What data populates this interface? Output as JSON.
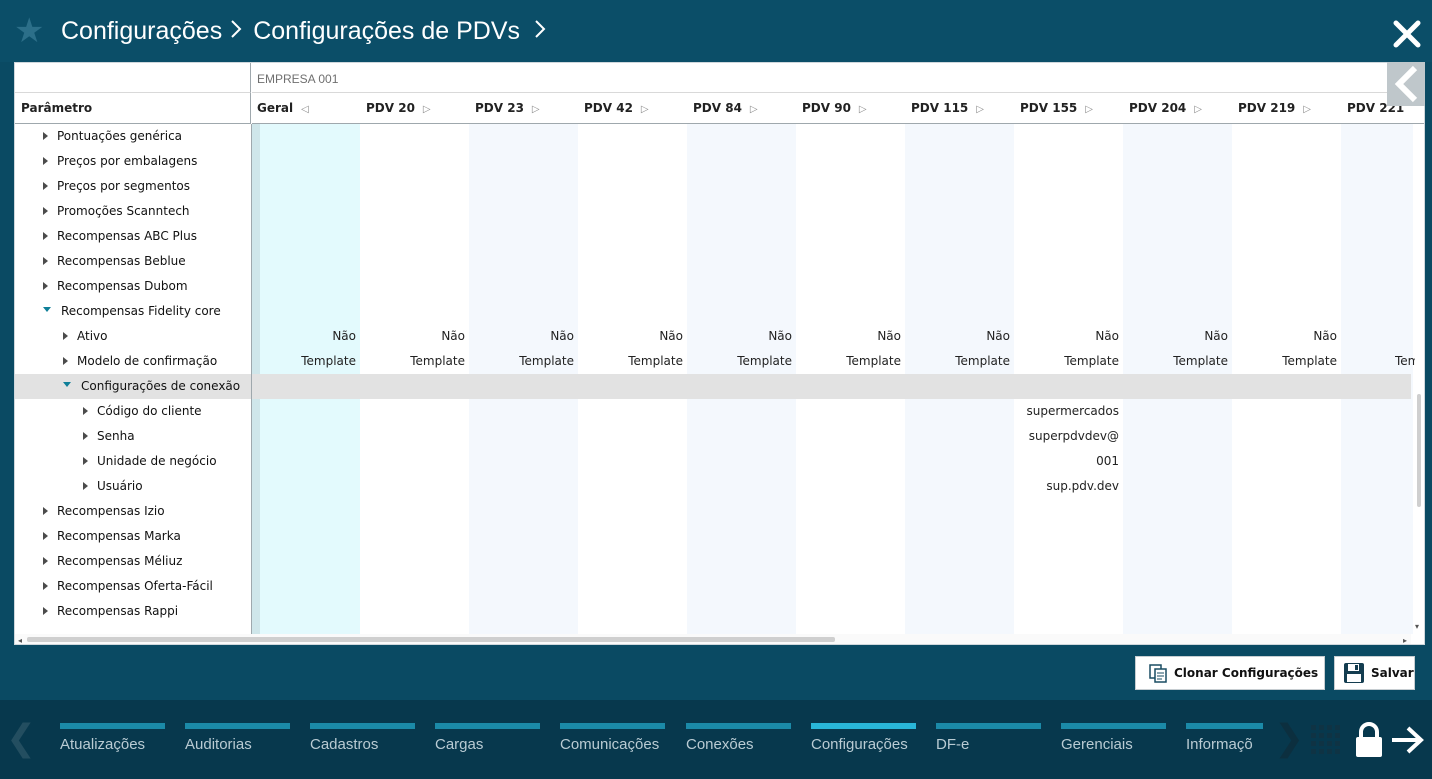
{
  "header": {
    "breadcrumbs": [
      "Configurações",
      "Configurações de PDVs"
    ]
  },
  "grid": {
    "company": "EMPRESA 001",
    "param_header": "Parâmetro",
    "columns": [
      "Geral",
      "PDV 20",
      "PDV 23",
      "PDV 42",
      "PDV 84",
      "PDV 90",
      "PDV 115",
      "PDV 155",
      "PDV 204",
      "PDV 219",
      "PDV 221"
    ],
    "tree": [
      {
        "label": "Pontuações genérica",
        "level": 0,
        "expanded": false
      },
      {
        "label": "Preços por embalagens",
        "level": 0,
        "expanded": false
      },
      {
        "label": "Preços por segmentos",
        "level": 0,
        "expanded": false
      },
      {
        "label": "Promoções Scanntech",
        "level": 0,
        "expanded": false
      },
      {
        "label": "Recompensas ABC Plus",
        "level": 0,
        "expanded": false
      },
      {
        "label": "Recompensas Beblue",
        "level": 0,
        "expanded": false
      },
      {
        "label": "Recompensas Dubom",
        "level": 0,
        "expanded": false
      },
      {
        "label": "Recompensas Fidelity core",
        "level": 0,
        "expanded": true
      },
      {
        "label": "Ativo",
        "level": 1,
        "expanded": false
      },
      {
        "label": "Modelo de confirmação",
        "level": 1,
        "expanded": false
      },
      {
        "label": "Configurações de conexão",
        "level": 1,
        "expanded": true
      },
      {
        "label": "Código do cliente",
        "level": 2,
        "expanded": false
      },
      {
        "label": "Senha",
        "level": 2,
        "expanded": false
      },
      {
        "label": "Unidade de negócio",
        "level": 2,
        "expanded": false
      },
      {
        "label": "Usuário",
        "level": 2,
        "expanded": false
      },
      {
        "label": "Recompensas Izio",
        "level": 0,
        "expanded": false
      },
      {
        "label": "Recompensas Marka",
        "level": 0,
        "expanded": false
      },
      {
        "label": "Recompensas Méliuz",
        "level": 0,
        "expanded": false
      },
      {
        "label": "Recompensas Oferta-Fácil",
        "level": 0,
        "expanded": false
      },
      {
        "label": "Recompensas Rappi",
        "level": 0,
        "expanded": false
      }
    ],
    "ativo_values": [
      "Não",
      "Não",
      "Não",
      "Não",
      "Não",
      "Não",
      "Não",
      "Não",
      "Não",
      "Não"
    ],
    "modelo_values": [
      "Template",
      "Template",
      "Template",
      "Template",
      "Template",
      "Template",
      "Template",
      "Template",
      "Template",
      "Template",
      "Tem"
    ],
    "pdv155_values": [
      "supermercados",
      "superpdvdev@",
      "001",
      "sup.pdv.dev"
    ]
  },
  "buttons": {
    "clone": "Clonar Configurações",
    "save": "Salvar"
  },
  "bottom_nav": {
    "tabs": [
      "Atualizações",
      "Auditorias",
      "Cadastros",
      "Cargas",
      "Comunicações",
      "Conexões",
      "Configurações",
      "DF-e",
      "Gerenciais",
      "Informaçõ"
    ],
    "active": "Configurações"
  },
  "colors": {
    "header_bg": "#0b4e68",
    "bottom_bg": "#07384d",
    "accent": "#1b8aa8",
    "active_accent": "#29b6d8",
    "geral_column": "#e3fafd"
  },
  "icons": [
    "star-icon",
    "chevron-right-icon",
    "close-icon",
    "collapse-panel-icon",
    "clone-icon",
    "save-icon",
    "grid-icon",
    "lock-icon",
    "arrow-right-icon"
  ]
}
